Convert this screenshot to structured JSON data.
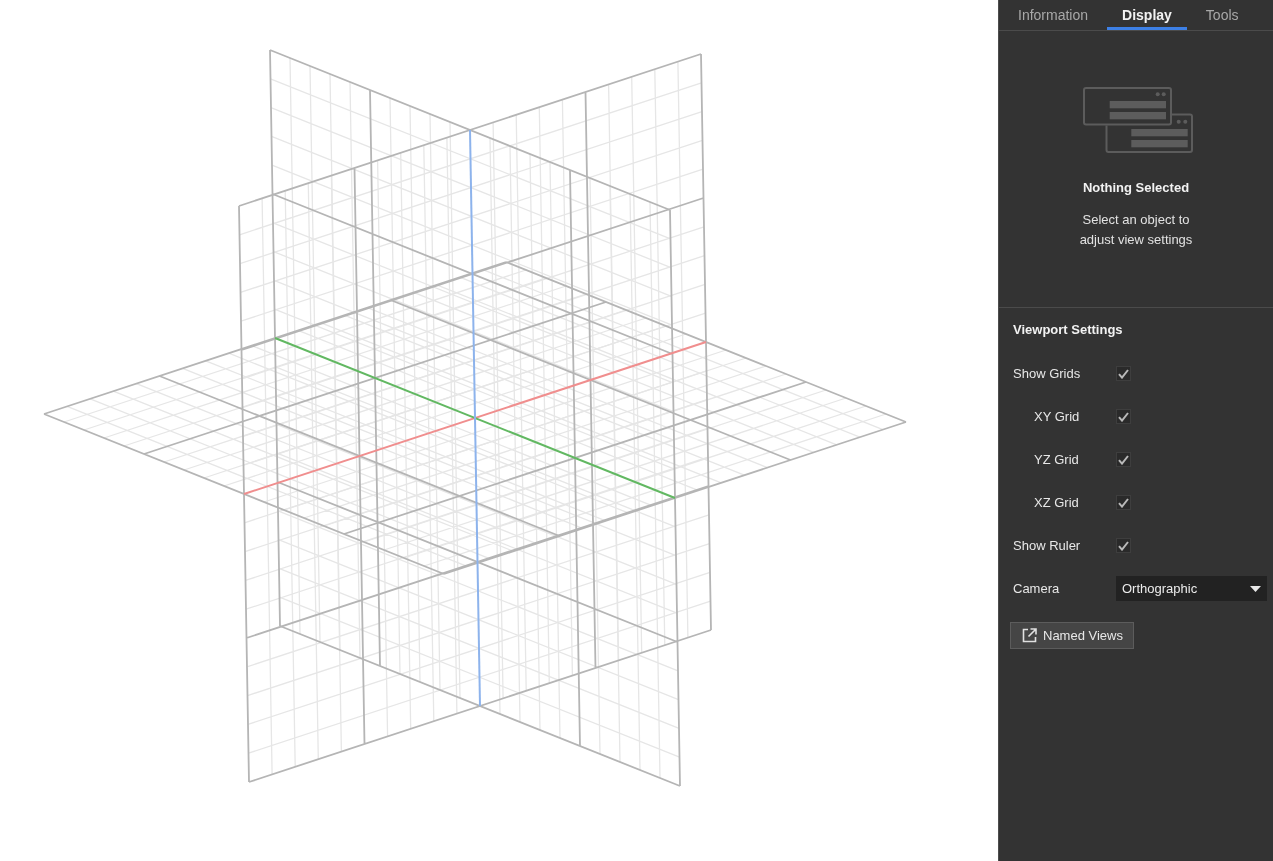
{
  "tabs": [
    {
      "label": "Information",
      "selected": false
    },
    {
      "label": "Display",
      "selected": true
    },
    {
      "label": "Tools",
      "selected": false
    }
  ],
  "empty_state": {
    "title": "Nothing Selected",
    "message": "Select an object to adjust view settings"
  },
  "viewport_settings": {
    "title": "Viewport Settings",
    "options": [
      {
        "label": "Show Grids",
        "checked": true,
        "children": [
          {
            "label": "XY Grid",
            "checked": true
          },
          {
            "label": "YZ Grid",
            "checked": true
          },
          {
            "label": "XZ Grid",
            "checked": true
          }
        ]
      },
      {
        "label": "Show Ruler",
        "checked": true
      }
    ],
    "camera": {
      "label": "Camera",
      "value": "Orthographic"
    },
    "named_views_button": "Named Views"
  }
}
